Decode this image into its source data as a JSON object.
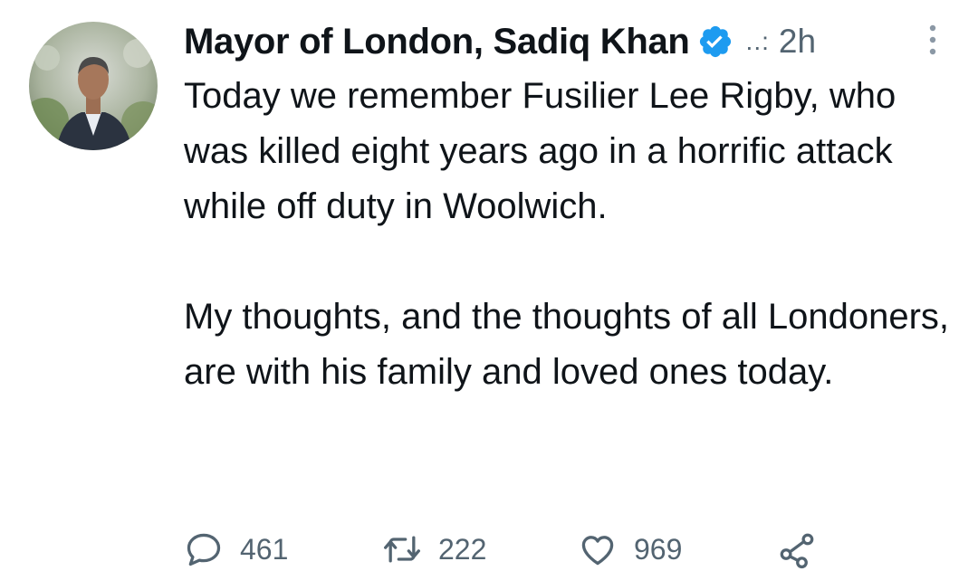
{
  "tweet": {
    "author": {
      "display_name": "Mayor of London, Sadiq Khan",
      "verified_icon": "verified-badge-icon",
      "translit_glyph": "..:",
      "timestamp": "2h"
    },
    "text_paragraphs": [
      "Today we remember Fusilier Lee Rigby, who was killed eight years ago in a horrific attack while off duty in Woolwich.",
      "My thoughts, and the thoughts of all Londoners, are with his family and loved ones today."
    ],
    "actions": {
      "reply_count": "461",
      "retweet_count": "222",
      "like_count": "969"
    }
  },
  "colors": {
    "text_primary": "#0f1419",
    "text_secondary": "#536471",
    "verified_blue": "#1d9bf0"
  }
}
